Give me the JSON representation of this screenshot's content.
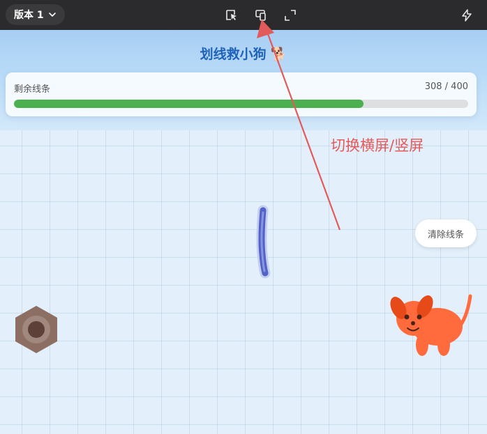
{
  "toolbar": {
    "version_label": "版本 1",
    "icons": [
      "cursor-select-icon",
      "device-rotate-icon",
      "fullscreen-icon",
      "magic-spark-icon"
    ]
  },
  "game": {
    "title": "划线救小狗",
    "title_emoji": "🐕",
    "progress": {
      "label": "剩余线条",
      "remaining": 308,
      "total": 400,
      "count_text": "308 / 400",
      "fill_fraction": 0.77
    },
    "clear_button_label": "清除线条"
  },
  "annotation": {
    "text": "切换横屏/竖屏"
  },
  "colors": {
    "progress_fill": "#4caf50",
    "title": "#1e63b8",
    "annotation": "#e35a5a",
    "dog": "#ff6b3d",
    "hive": "#8d6e63",
    "line": "#5060c8"
  }
}
